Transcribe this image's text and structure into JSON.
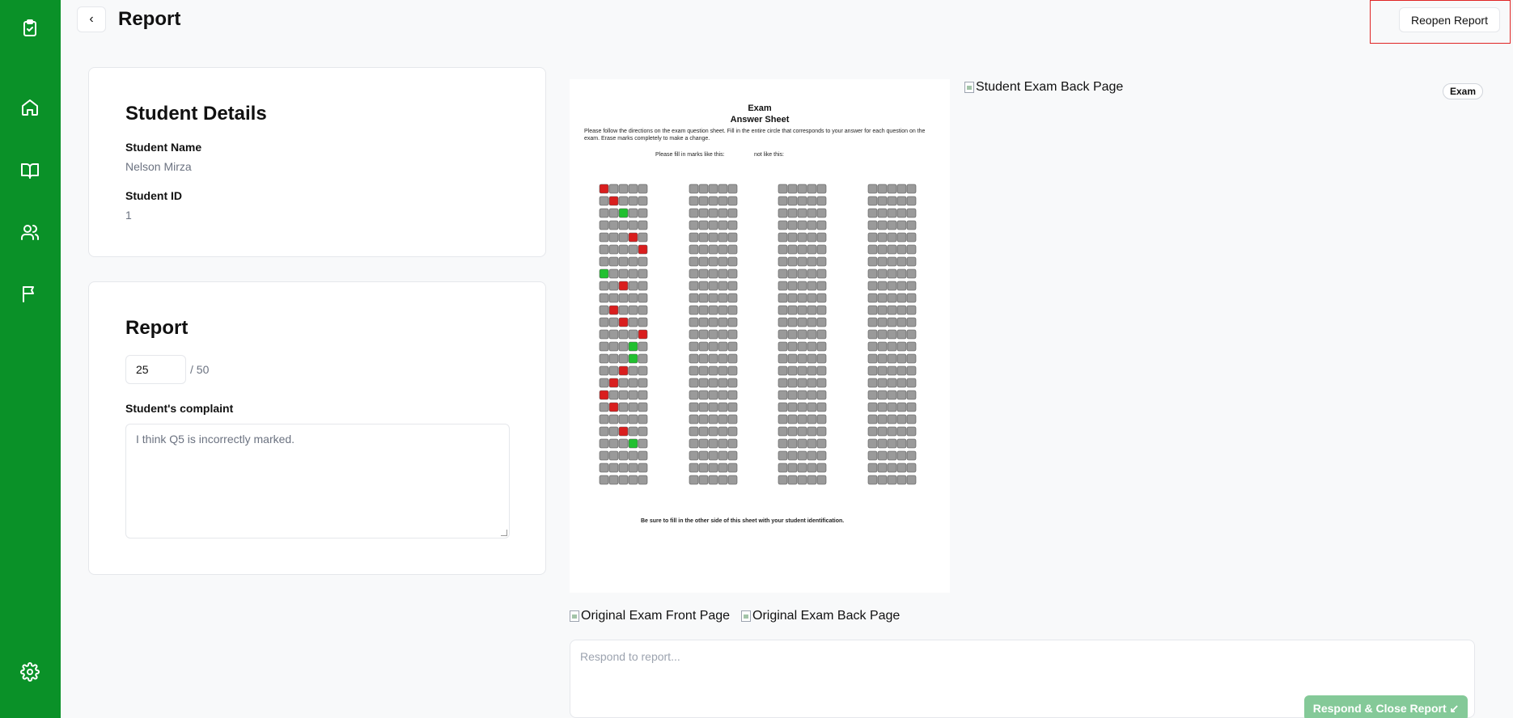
{
  "header": {
    "back_label": "‹",
    "title": "Report",
    "reopen_label": "Reopen Report"
  },
  "sidebar": {
    "items": [
      {
        "icon": "clipboard-check-icon"
      },
      {
        "icon": "home-icon"
      },
      {
        "icon": "book-icon"
      },
      {
        "icon": "users-icon"
      },
      {
        "icon": "flag-icon"
      },
      {
        "icon": "gear-icon"
      }
    ]
  },
  "student_details": {
    "heading": "Student Details",
    "name_label": "Student Name",
    "name_value": "Nelson Mirza",
    "id_label": "Student ID",
    "id_value": "1"
  },
  "report": {
    "heading": "Report",
    "score": "25",
    "total": "/ 50",
    "complaint_label": "Student's complaint",
    "complaint_text": "I think Q5 is incorrectly marked."
  },
  "exam": {
    "badge": "Exam",
    "back_page_alt": "Student Exam Back Page",
    "original_front_alt": "Original Exam Front Page",
    "original_back_alt": "Original Exam Back Page",
    "sheet": {
      "title_line1": "Exam",
      "title_line2": "Answer Sheet",
      "instructions": "Please follow the directions on the exam question sheet. Fill in the entire circle that corresponds to your answer for each question on the exam. Erase marks completely to make a change.",
      "fill_label": "Please fill in marks like this:",
      "not_like": "not like this:",
      "footer": "Be sure to fill in the other side of this sheet with your student identification."
    }
  },
  "respond": {
    "placeholder": "Respond to report...",
    "button_label": "Respond & Close Report ↙"
  },
  "colors": {
    "sidebar": "#0a9128",
    "accent_button": "#84c998",
    "highlight": "#e02424"
  }
}
